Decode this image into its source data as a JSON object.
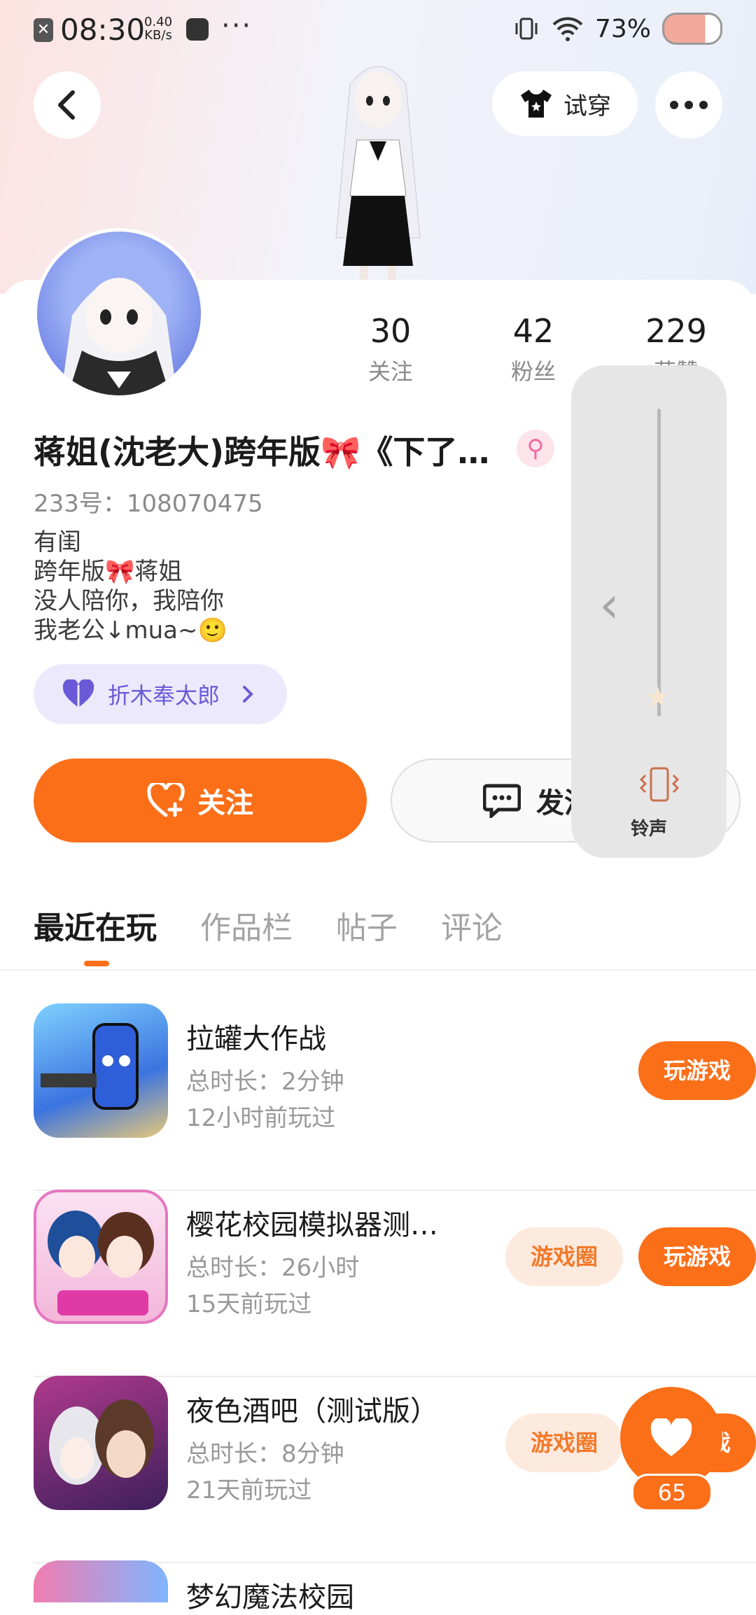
{
  "status_bar": {
    "time": "08:30",
    "speed_value": "0.40",
    "speed_unit": "KB/s",
    "more": "···",
    "battery": "73%"
  },
  "header": {
    "try_on_label": "试穿"
  },
  "profile": {
    "name": "蒋姐(沈老大)跨年版🎀《下了…",
    "gender_symbol": "⚲",
    "uid": "233号：108070475",
    "bio_lines": [
      "有闺",
      "跨年版🎀蒋姐",
      "没人陪你，我陪你",
      "我老公↓mua~🙂"
    ],
    "cp_name": "折木奉太郎",
    "stats": [
      {
        "number": "30",
        "label": "关注"
      },
      {
        "number": "42",
        "label": "粉丝"
      },
      {
        "number": "229",
        "label": "获赞"
      }
    ]
  },
  "actions": {
    "follow_label": "关注",
    "message_label": "发消息"
  },
  "volume_panel": {
    "label": "铃声",
    "level": 0.05
  },
  "tabs": [
    "最近在玩",
    "作品栏",
    "帖子",
    "评论"
  ],
  "games": [
    {
      "title": "拉罐大作战",
      "duration": "总时长：2分钟",
      "last_played": "12小时前玩过",
      "circle": "",
      "play": "玩游戏"
    },
    {
      "title": "樱花校园模拟器测…",
      "duration": "总时长：26小时",
      "last_played": "15天前玩过",
      "circle": "游戏圈",
      "play": "玩游戏"
    },
    {
      "title": "夜色酒吧（测试版）",
      "duration": "总时长：8分钟",
      "last_played": "21天前玩过",
      "circle": "游戏圈",
      "play": "玩游戏"
    },
    {
      "title": "梦幻魔法校园"
    }
  ],
  "favorite": {
    "count": "65"
  },
  "colors": {
    "accent": "#fb6f19",
    "cp_purple": "#6a5ad8"
  }
}
